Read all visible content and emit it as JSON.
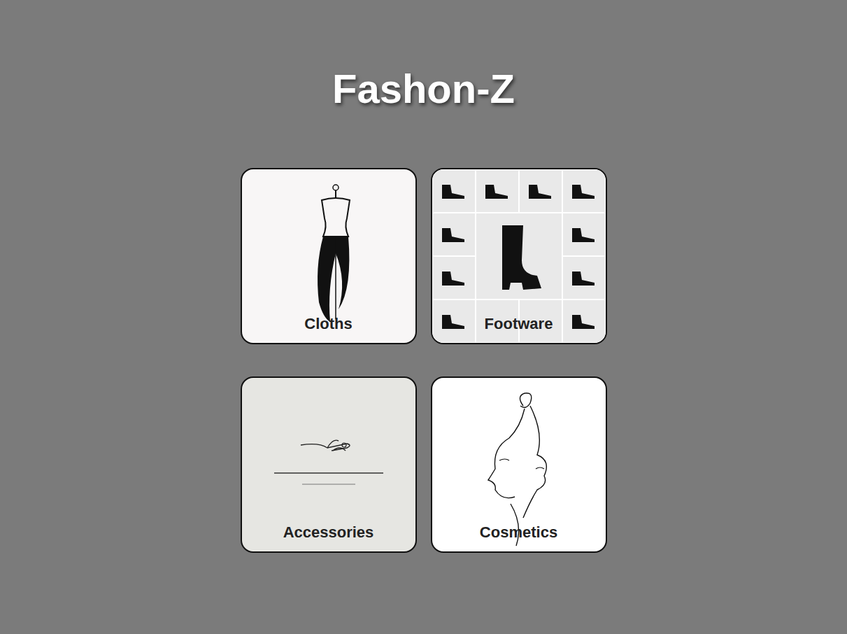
{
  "title": "Fashon-Z",
  "categories": [
    {
      "label": "Cloths",
      "kind": "dress"
    },
    {
      "label": "Footware",
      "kind": "footwear"
    },
    {
      "label": "Accessories",
      "kind": "jewellery"
    },
    {
      "label": "Cosmetics",
      "kind": "cosmetics"
    }
  ]
}
